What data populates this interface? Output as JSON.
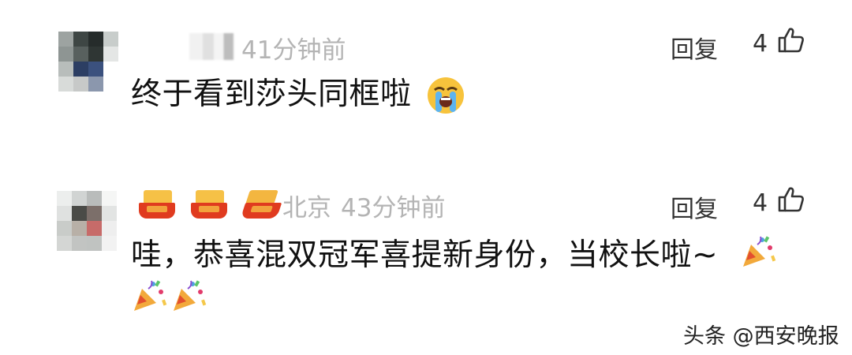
{
  "comments": [
    {
      "time": "41分钟前",
      "reply_label": "回复",
      "likes": "4",
      "text": "终于看到莎头同框啦"
    },
    {
      "location": "北京",
      "time": "43分钟前",
      "reply_label": "回复",
      "likes": "4",
      "text": "哇，恭喜混双冠军喜提新身份，当校长啦~"
    }
  ],
  "watermark": "头条 @西安晚报",
  "icons": {
    "like": "thumbs-up-icon",
    "crying_emoji": "loudly-crying-face-emoji",
    "party_emoji": "party-popper-emoji"
  },
  "colors": {
    "meta_gray": "#b4b4b4",
    "text": "#111111",
    "badge_red": "#e03b1f",
    "badge_yellow": "#f6c146"
  }
}
